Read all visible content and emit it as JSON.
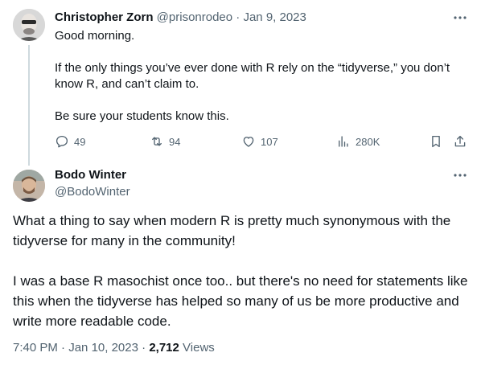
{
  "tweet": {
    "author_name": "Christopher Zorn",
    "author_handle": "@prisonrodeo",
    "separator": "·",
    "date": "Jan 9, 2023",
    "lines": [
      "Good morning.",
      "If the only things you’ve ever done with R rely on the “tidyverse,” you don’t know R, and can’t claim to.",
      "Be sure your students know this."
    ],
    "actions": {
      "replies": "49",
      "retweets": "94",
      "likes": "107",
      "views": "280K"
    }
  },
  "reply": {
    "author_name": "Bodo Winter",
    "author_handle": "@BodoWinter",
    "paragraphs": [
      "What a thing to say when modern R is pretty much synonymous with the tidyverse for many in the community!",
      "I was a base R masochist once too.. but there's no need for statements like this when the tidyverse has helped so many of us be more productive and write more readable code."
    ],
    "time": "7:40 PM",
    "date": "Jan 10, 2023",
    "separator": "·",
    "views_count": "2,712",
    "views_label": "Views"
  },
  "icons": {
    "more": "more-horizontal-icon",
    "reply": "reply-icon",
    "retweet": "retweet-icon",
    "like": "heart-icon",
    "views": "analytics-icon",
    "bookmark": "bookmark-icon",
    "share": "share-icon"
  },
  "colors": {
    "text_primary": "#0f1419",
    "text_muted": "#536471",
    "thread_line": "#cfd9de"
  }
}
